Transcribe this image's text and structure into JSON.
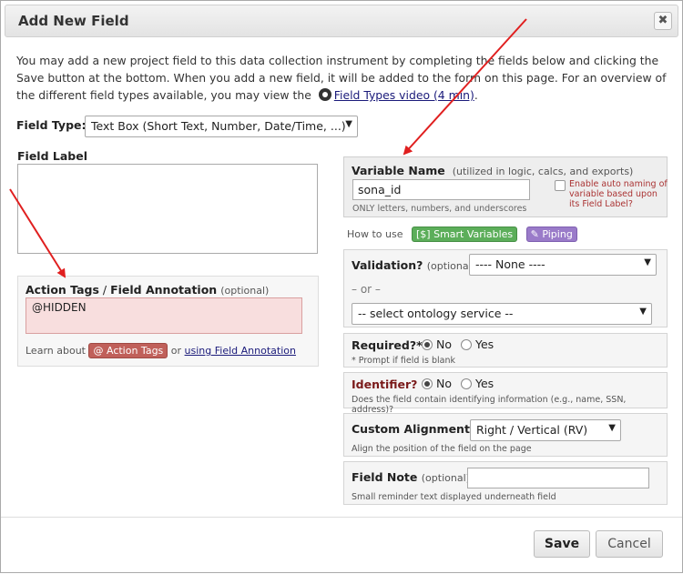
{
  "dialog": {
    "title": "Add New Field",
    "close_icon": "close-icon"
  },
  "intro": {
    "text": "You may add a new project field to this data collection instrument by completing the fields below and clicking the Save button at the bottom. When you add a new field, it will be added to the form on this page. For an overview of the different field types available, you may view the",
    "video_link": "Field Types video (4 min)",
    "end": "."
  },
  "field_type": {
    "label": "Field Type:",
    "selected": "Text Box (Short Text, Number, Date/Time, ...)"
  },
  "field_label": {
    "title": "Field Label",
    "value": ""
  },
  "action_tags": {
    "title_a": "Action Tags",
    "sep": " / ",
    "title_b": "Field Annotation",
    "optional": "(optional)",
    "value": "@HIDDEN",
    "learn_about": "Learn about",
    "badge": "@ Action Tags",
    "or": "or",
    "annotation_link": "using Field Annotation"
  },
  "variable": {
    "title": "Variable Name",
    "note": "(utilized in logic, calcs, and exports)",
    "value": "sona_id",
    "hint": "ONLY letters, numbers, and underscores",
    "auto_naming": "Enable auto naming of variable based upon its Field Label?"
  },
  "howto": {
    "label": "How to use",
    "smart": "[$] Smart Variables",
    "piping": "Piping"
  },
  "validation": {
    "title": "Validation?",
    "optional": "(optional)",
    "selected": "---- None ----",
    "or": "– or –",
    "ontology": "-- select ontology service --"
  },
  "required": {
    "title": "Required?*",
    "no": "No",
    "yes": "Yes",
    "note": "* Prompt if field is blank"
  },
  "identifier": {
    "title": "Identifier?",
    "no": "No",
    "yes": "Yes",
    "note": "Does the field contain identifying information (e.g., name, SSN, address)?"
  },
  "alignment": {
    "title": "Custom Alignment",
    "selected": "Right / Vertical (RV)",
    "note": "Align the position of the field on the page"
  },
  "field_note": {
    "title": "Field Note",
    "optional": "(optional)",
    "value": "",
    "note": "Small reminder text displayed underneath field"
  },
  "footer": {
    "save": "Save",
    "cancel": "Cancel"
  },
  "colors": {
    "annotation_arrow": "#e01f1f",
    "identifier_title": "#7a1a1a"
  }
}
